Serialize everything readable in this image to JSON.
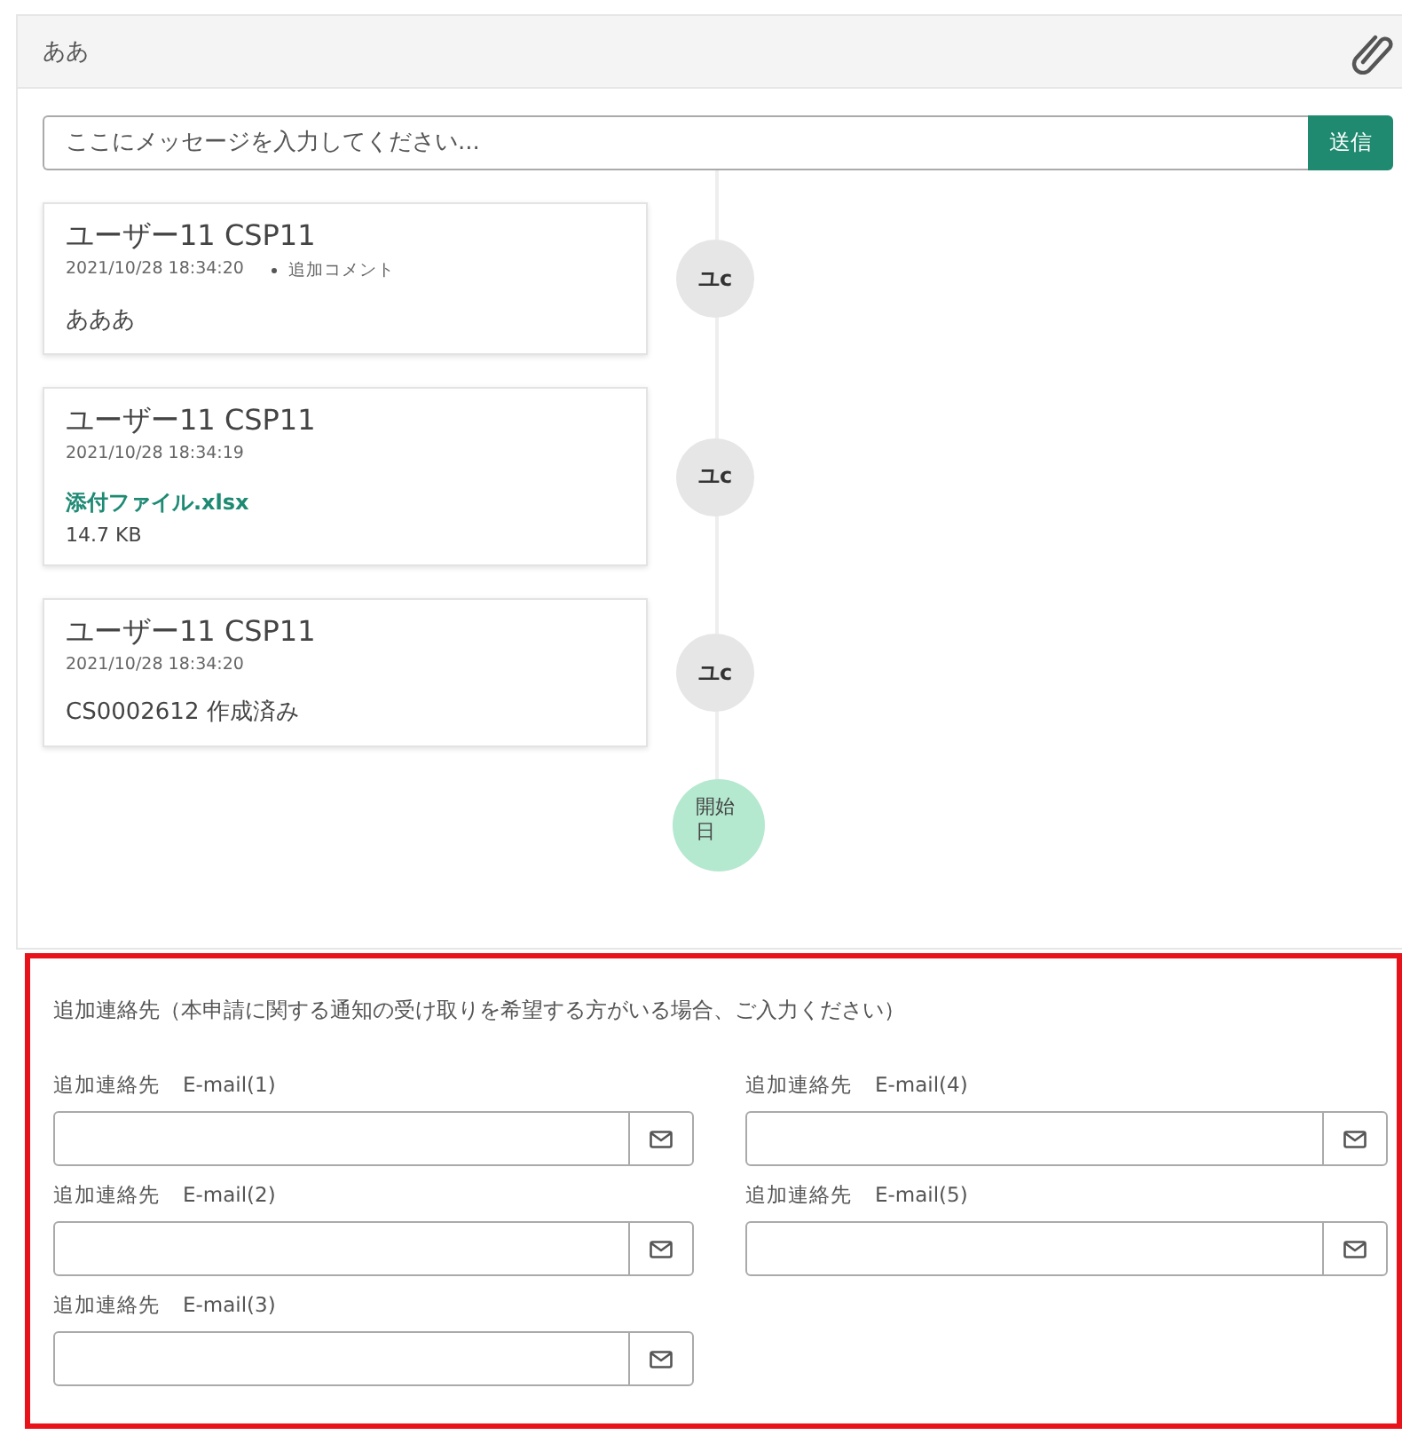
{
  "panel": {
    "title": "ああ"
  },
  "composer": {
    "placeholder": "ここにメッセージを入力してください...",
    "send_label": "送信"
  },
  "timeline": [
    {
      "kind": "comment",
      "author": "ユーザー11 CSP11",
      "timestamp": "2021/10/28 18:34:20",
      "tag": "追加コメント",
      "body": "あああ",
      "avatar": "ユc"
    },
    {
      "kind": "attachment",
      "author": "ユーザー11 CSP11",
      "timestamp": "2021/10/28 18:34:19",
      "file_name": "添付ファイル.xlsx",
      "file_size": "14.7 KB",
      "avatar": "ユc"
    },
    {
      "kind": "record",
      "author": "ユーザー11 CSP11",
      "timestamp": "2021/10/28 18:34:20",
      "body": "CS0002612 作成済み",
      "avatar": "ユc"
    }
  ],
  "timeline_start": "開始日",
  "contacts": {
    "heading": "追加連絡先（本申請に関する通知の受け取りを希望する方がいる場合、ご入力ください）",
    "fields": [
      {
        "label": "追加連絡先",
        "sublabel": "E-mail(1)"
      },
      {
        "label": "追加連絡先",
        "sublabel": "E-mail(2)"
      },
      {
        "label": "追加連絡先",
        "sublabel": "E-mail(3)"
      },
      {
        "label": "追加連絡先",
        "sublabel": "E-mail(4)"
      },
      {
        "label": "追加連絡先",
        "sublabel": "E-mail(5)"
      }
    ]
  }
}
